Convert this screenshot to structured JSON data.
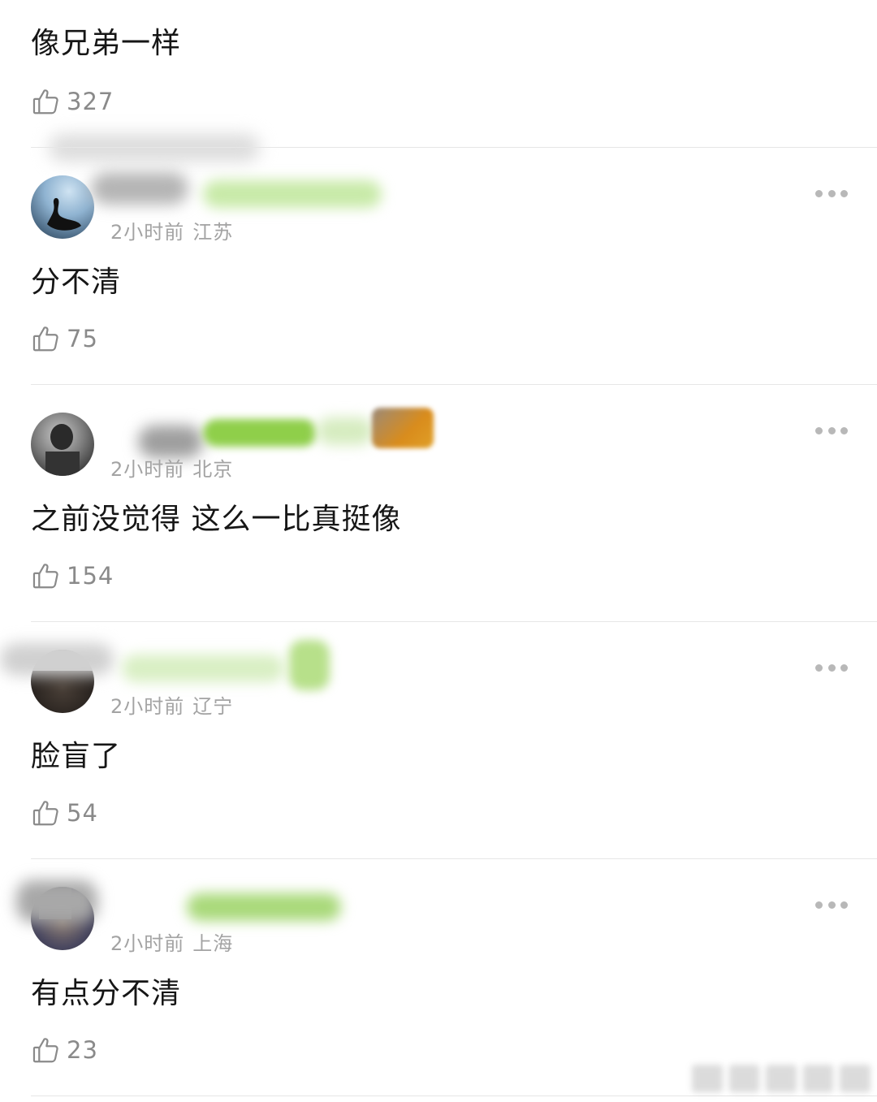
{
  "first_comment": {
    "text": "像兄弟一样",
    "likes": "327"
  },
  "comments": [
    {
      "time": "2小时前",
      "location": "江苏",
      "text": "分不清",
      "likes": "75",
      "accent": "#9fd36a"
    },
    {
      "time": "2小时前",
      "location": "北京",
      "text": "之前没觉得 这么一比真挺像",
      "likes": "154",
      "accent": "#8fcf4a"
    },
    {
      "time": "2小时前",
      "location": "辽宁",
      "text": "脸盲了",
      "likes": "54",
      "accent": "#b7e08a"
    },
    {
      "time": "2小时前",
      "location": "上海",
      "text": "有点分不清",
      "likes": "23",
      "accent": "#9fd36a"
    }
  ],
  "icons": {
    "like": "thumbs-up-icon",
    "more": "more-horizontal-icon"
  },
  "colors": {
    "text": "#161616",
    "meta": "#a3a3a3",
    "divider": "#e6e6e6",
    "blur_green": "#9fd36a"
  }
}
